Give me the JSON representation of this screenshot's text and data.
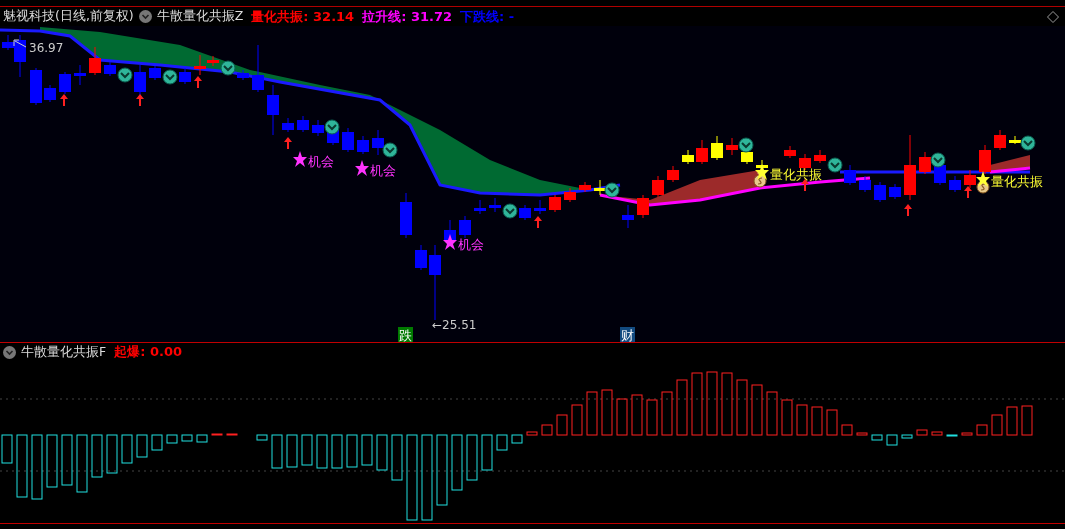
{
  "header": {
    "stock": "魅视科技(日线,前复权)",
    "indicator": "牛散量化共振Z",
    "readings": [
      {
        "text": "量化共振: 32.14",
        "color": "#ff0000"
      },
      {
        "text": "拉升线: 31.72",
        "color": "#ff00ff"
      },
      {
        "text": "下跌线: -",
        "color": "#0000ff"
      }
    ]
  },
  "price_chart": {
    "high_label": "36.97",
    "low_label": "←25.51",
    "annotations": [
      {
        "kind": "opportunity",
        "text": "机会"
      },
      {
        "kind": "opportunity",
        "text": "机会"
      },
      {
        "kind": "opportunity",
        "text": "机会"
      },
      {
        "kind": "resonance",
        "text": "量化共振"
      },
      {
        "kind": "resonance",
        "text": "量化共振"
      }
    ],
    "signals": [
      {
        "text": "跌",
        "color": "#007a00"
      },
      {
        "text": "财",
        "color": "#124a80"
      }
    ]
  },
  "sub_header": {
    "indicator": "牛散量化共振F",
    "readings": [
      {
        "text": "起爆: 0.00",
        "color": "#ff0000"
      }
    ]
  }
}
